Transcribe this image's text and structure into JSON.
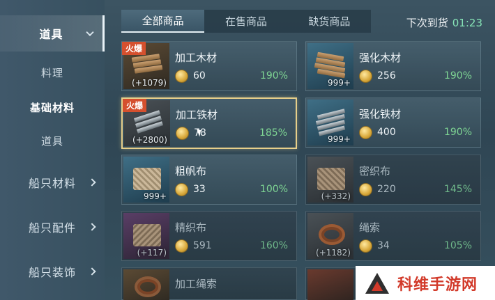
{
  "sidebar": {
    "items": [
      {
        "label": "道具",
        "active": true
      },
      {
        "label": "料理"
      },
      {
        "label": "基础材料",
        "selected": true
      },
      {
        "label": "道具"
      },
      {
        "label": "船只材料"
      },
      {
        "label": "船只配件"
      },
      {
        "label": "船只装饰"
      }
    ]
  },
  "tabs": [
    {
      "label": "全部商品"
    },
    {
      "label": "在售商品"
    },
    {
      "label": "缺货商品"
    }
  ],
  "restock": {
    "label": "下次到货",
    "timer": "01:23"
  },
  "hot_badge": "火爆",
  "items": [
    {
      "name": "加工木材",
      "price": "60",
      "pct": "190%",
      "qty": "(+1079)",
      "hot": true,
      "icon": "wood-plank-icon"
    },
    {
      "name": "强化木材",
      "price": "256",
      "pct": "190%",
      "qty": "999+",
      "icon": "reinforced-wood-icon"
    },
    {
      "name": "加工铁材",
      "price": "78",
      "pct": "185%",
      "qty": "(+2800)",
      "hot": true,
      "icon": "iron-sheet-icon"
    },
    {
      "name": "强化铁材",
      "price": "400",
      "pct": "190%",
      "qty": "999+",
      "icon": "reinforced-iron-icon"
    },
    {
      "name": "粗帆布",
      "price": "33",
      "pct": "100%",
      "qty": "999+",
      "icon": "canvas-cloth-icon"
    },
    {
      "name": "密织布",
      "price": "220",
      "pct": "145%",
      "qty": "(+332)",
      "icon": "dense-cloth-icon"
    },
    {
      "name": "精织布",
      "price": "591",
      "pct": "160%",
      "qty": "(+117)",
      "icon": "fine-cloth-icon"
    },
    {
      "name": "绳索",
      "price": "34",
      "pct": "105%",
      "qty": "(+1182)",
      "icon": "rope-icon"
    },
    {
      "name": "加工绳索",
      "icon": "processed-rope-icon"
    }
  ],
  "watermark": {
    "text": "科维手游网"
  },
  "colors": {
    "hot": "#d5502e",
    "percent": "#7fd694",
    "selected_border": "#e7cf8a",
    "timer": "#86e3b6"
  }
}
